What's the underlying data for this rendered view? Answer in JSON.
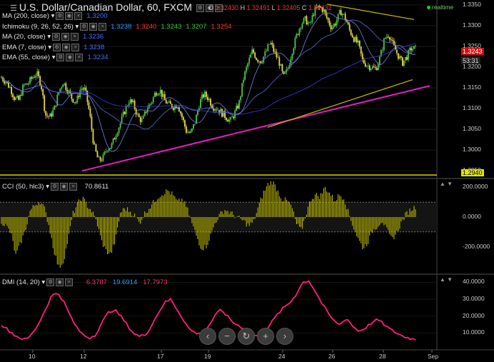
{
  "header": {
    "title": "U.S. Dollar/Canadian Dollar, 60, FXCM",
    "ohlc": {
      "o_label": "O",
      "o": "1.32430",
      "h_label": "H",
      "h": "1.32491",
      "l_label": "L",
      "l": "1.32405",
      "c_label": "C",
      "c": "1.32432"
    },
    "realtime": "realtime"
  },
  "indicators": [
    {
      "label": "MA (200, close)",
      "values": [
        "1.3200"
      ],
      "colors": [
        "#4a6cff"
      ]
    },
    {
      "label": "Ichimoku (9, 26, 52, 26)",
      "values": [
        "1.3238",
        "1.3240",
        "1.3243",
        "1.3207",
        "1.3254"
      ],
      "colors": [
        "#3399ff",
        "#ff3333",
        "#33cc33",
        "#33cc33",
        "#ff3333"
      ]
    },
    {
      "label": "MA (20, close)",
      "values": [
        "1.3236"
      ],
      "colors": [
        "#4a6cff"
      ]
    },
    {
      "label": "EMA (7, close)",
      "values": [
        "1.3238"
      ],
      "colors": [
        "#4a6cff"
      ]
    },
    {
      "label": "EMA (55, close)",
      "values": [
        "1.3234"
      ],
      "colors": [
        "#4a6cff"
      ]
    }
  ],
  "price_axis": {
    "ticks": [
      "1.3350",
      "1.3300",
      "1.3250",
      "1.3200",
      "1.3150",
      "1.3100",
      "1.3050",
      "1.3000",
      "1.2950"
    ],
    "current": "1.3243",
    "countdown": "53:31",
    "support": "1.2940"
  },
  "cci_panel": {
    "label": "CCI (50, hlc3)",
    "value": "70.8611",
    "value_color": "#e0e000",
    "ticks": [
      "200.0000",
      "0.0000",
      "-200.0000"
    ]
  },
  "dmi_panel": {
    "label": "DMI (14, 20)",
    "values": [
      "6.3787",
      "19.6914",
      "17.7973"
    ],
    "colors": [
      "#ff3366",
      "#3399ff",
      "#ff3366"
    ],
    "ticks": [
      "40.0000",
      "30.0000",
      "20.0000",
      "10.0000"
    ]
  },
  "x_axis": {
    "labels": [
      "10",
      "12",
      "17",
      "19",
      "24",
      "26",
      "28",
      "Sep"
    ]
  },
  "zoom_controls": [
    {
      "name": "scroll-left-button",
      "glyph": "‹"
    },
    {
      "name": "zoom-out-button",
      "glyph": "−"
    },
    {
      "name": "reset-button",
      "glyph": "↻"
    },
    {
      "name": "zoom-in-button",
      "glyph": "+"
    },
    {
      "name": "scroll-right-button",
      "glyph": "›"
    }
  ],
  "chart_data": {
    "type": "candlestick",
    "price_range": [
      1.2935,
      1.3362
    ],
    "cci_range": [
      -380,
      250
    ],
    "dmi_range": [
      0,
      44
    ],
    "price_path": [
      1.3175,
      1.3165,
      1.315,
      1.3125,
      1.312,
      1.3155,
      1.316,
      1.3175,
      1.3185,
      1.316,
      1.3085,
      1.308,
      1.31,
      1.314,
      1.3165,
      1.3145,
      1.3125,
      1.3115,
      1.315,
      1.3145,
      1.309,
      1.301,
      1.2975,
      1.298,
      1.3005,
      1.301,
      1.304,
      1.3065,
      1.3095,
      1.312,
      1.311,
      1.308,
      1.307,
      1.31,
      1.3115,
      1.314,
      1.3145,
      1.312,
      1.311,
      1.3105,
      1.311,
      1.308,
      1.3045,
      1.304,
      1.307,
      1.3115,
      1.3135,
      1.3125,
      1.3105,
      1.31,
      1.309,
      1.308,
      1.307,
      1.309,
      1.3115,
      1.3175,
      1.321,
      1.324,
      1.322,
      1.3215,
      1.3235,
      1.326,
      1.3235,
      1.3215,
      1.3175,
      1.3195,
      1.324,
      1.3275,
      1.3305,
      1.3315,
      1.33,
      1.3335,
      1.3345,
      1.334,
      1.3315,
      1.3295,
      1.331,
      1.3335,
      1.332,
      1.329,
      1.327,
      1.3255,
      1.3215,
      1.3205,
      1.32,
      1.3195,
      1.3225,
      1.327,
      1.328,
      1.325,
      1.323,
      1.321,
      1.3225,
      1.3245,
      1.3245
    ],
    "cci_path": [
      -30,
      -60,
      -110,
      -260,
      -180,
      -90,
      40,
      80,
      110,
      60,
      -60,
      -220,
      -340,
      -300,
      -150,
      20,
      90,
      130,
      80,
      40,
      -30,
      -160,
      -230,
      -250,
      -150,
      30,
      60,
      40,
      10,
      -40,
      20,
      60,
      100,
      140,
      160,
      180,
      150,
      100,
      120,
      60,
      -40,
      -130,
      -210,
      -200,
      -120,
      -30,
      20,
      50,
      30,
      10,
      -10,
      -30,
      -60,
      -30,
      70,
      160,
      220,
      240,
      180,
      120,
      110,
      70,
      -50,
      -90,
      20,
      120,
      150,
      140,
      200,
      160,
      110,
      150,
      130,
      20,
      -70,
      -150,
      -210,
      -170,
      -90,
      -60,
      -20,
      -90,
      -150,
      -110,
      -40,
      20,
      50,
      70
    ],
    "dmi_path": [
      15,
      12,
      9,
      7,
      6,
      10,
      16,
      24,
      32,
      34,
      28,
      20,
      13,
      9,
      7,
      9,
      16,
      22,
      24,
      20,
      15,
      10,
      8,
      9,
      15,
      22,
      28,
      30,
      24,
      18,
      12,
      10,
      9,
      14,
      20,
      24,
      20,
      16,
      14,
      12,
      9,
      8,
      11,
      16,
      21,
      25,
      28,
      33,
      40,
      41,
      35,
      28,
      22,
      17,
      15,
      19,
      14,
      11,
      13,
      16,
      18,
      15,
      12,
      10,
      8,
      7,
      6
    ]
  }
}
